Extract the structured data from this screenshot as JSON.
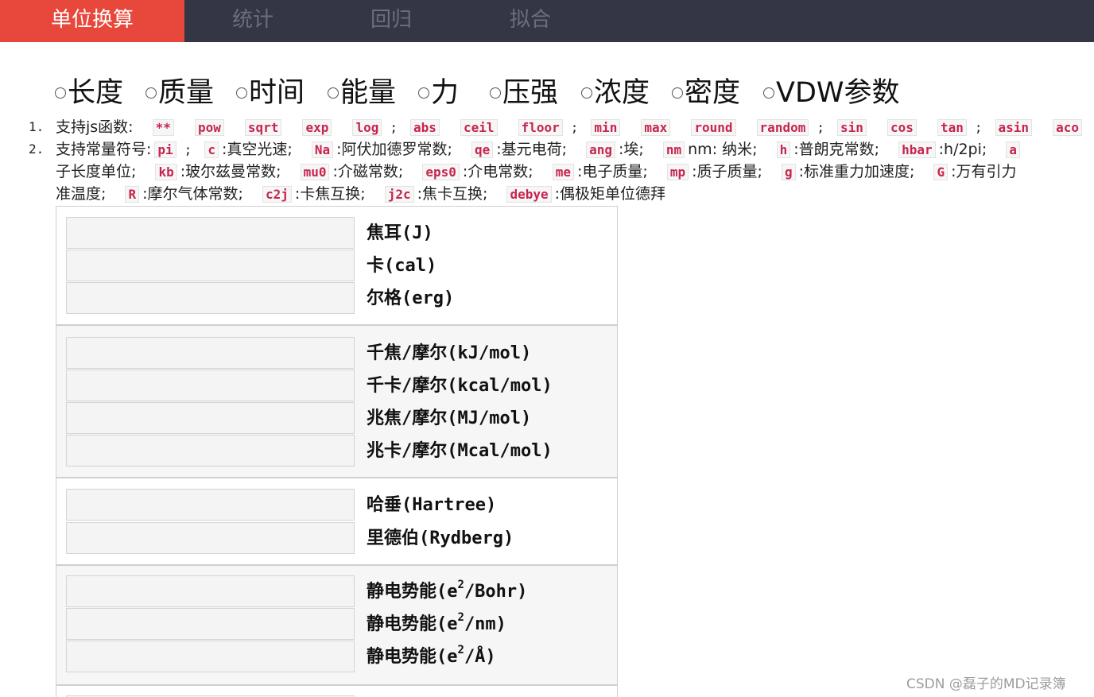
{
  "nav": {
    "tabs": [
      {
        "label": "单位换算",
        "active": true
      },
      {
        "label": "统计",
        "active": false
      },
      {
        "label": "回归",
        "active": false
      },
      {
        "label": "拟合",
        "active": false
      }
    ]
  },
  "categories": [
    "长度",
    "质量",
    "时间",
    "能量",
    "力",
    "压强",
    "浓度",
    "密度",
    "VDW参数"
  ],
  "help": {
    "functions_label": "支持js函数:",
    "functions": [
      "**",
      "pow",
      "sqrt",
      "exp",
      "log",
      "abs",
      "ceil",
      "floor",
      "min",
      "max",
      "round",
      "random",
      "sin",
      "cos",
      "tan",
      "asin",
      "aco"
    ],
    "constants_label": "支持常量符号:",
    "constants_line1": [
      {
        "code": "pi",
        "desc": ""
      },
      {
        "code": "c",
        "desc": ":真空光速;"
      },
      {
        "code": "Na",
        "desc": ":阿伏加德罗常数;"
      },
      {
        "code": "qe",
        "desc": ":基元电荷;"
      },
      {
        "code": "ang",
        "desc": ":埃;"
      },
      {
        "code": "nm",
        "desc": "nm: 纳米;"
      },
      {
        "code": "h",
        "desc": ":普朗克常数;"
      },
      {
        "code": "hbar",
        "desc": ":h/2pi;"
      },
      {
        "code": "a",
        "desc": ""
      }
    ],
    "constants_line2_prefix": "子长度单位;",
    "constants_line2": [
      {
        "code": "kb",
        "desc": ":玻尔兹曼常数;"
      },
      {
        "code": "mu0",
        "desc": ":介磁常数;"
      },
      {
        "code": "eps0",
        "desc": ":介电常数;"
      },
      {
        "code": "me",
        "desc": ":电子质量;"
      },
      {
        "code": "mp",
        "desc": ":质子质量;"
      },
      {
        "code": "g",
        "desc": ":标准重力加速度;"
      },
      {
        "code": "G",
        "desc": ":万有引力"
      }
    ],
    "constants_line3_prefix": "准温度;",
    "constants_line3": [
      {
        "code": "R",
        "desc": ":摩尔气体常数;"
      },
      {
        "code": "c2j",
        "desc": ":卡焦互换;"
      },
      {
        "code": "j2c",
        "desc": ":焦卡互换;"
      },
      {
        "code": "debye",
        "desc": ":偶极矩单位德拜"
      }
    ]
  },
  "units": {
    "g0": [
      "焦耳(J)",
      "卡(cal)",
      "尔格(erg)"
    ],
    "g1": [
      "千焦/摩尔(kJ/mol)",
      "千卡/摩尔(kcal/mol)",
      "兆焦/摩尔(MJ/mol)",
      "兆卡/摩尔(Mcal/mol)"
    ],
    "g2": [
      "哈垂(Hartree)",
      "里德伯(Rydberg)"
    ],
    "g3": [
      {
        "pre": "静电势能(e",
        "sup": "2",
        "post": "/Bohr)"
      },
      {
        "pre": "静电势能(e",
        "sup": "2",
        "post": "/nm)"
      },
      {
        "pre": "静电势能(e",
        "sup": "2",
        "post": "/Å)"
      }
    ]
  },
  "watermark": "CSDN @磊子的MD记录簿",
  "colors": {
    "nav_bg": "#353645",
    "active_tab": "#e8473b",
    "code_text": "#c7254e"
  }
}
